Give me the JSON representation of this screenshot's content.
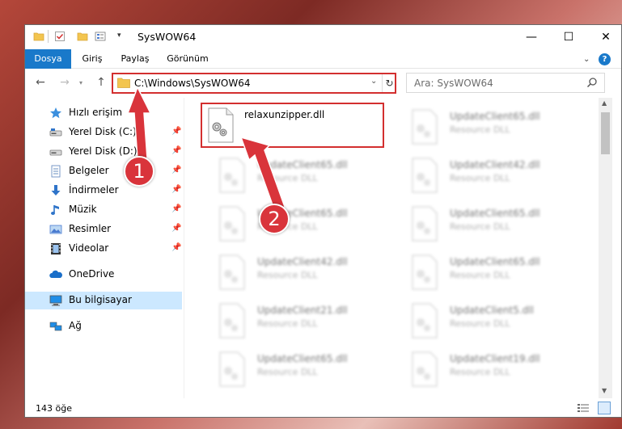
{
  "window": {
    "title": "SysWOW64",
    "controls": {
      "minimize": "—",
      "maximize": "☐",
      "close": "✕"
    }
  },
  "ribbon": {
    "file_tab": "Dosya",
    "tabs": [
      "Giriş",
      "Paylaş",
      "Görünüm"
    ],
    "help": "?"
  },
  "navigation": {
    "address": "C:\\Windows\\SysWOW64",
    "search_placeholder": "Ara: SysWOW64"
  },
  "sidebar": {
    "items": [
      {
        "label": "Hızlı erişim",
        "icon": "star-icon",
        "pinned": false,
        "selected": false
      },
      {
        "label": "Yerel Disk (C:)",
        "icon": "drive-icon",
        "pinned": true,
        "selected": false
      },
      {
        "label": "Yerel Disk (D:)",
        "icon": "drive-icon",
        "pinned": true,
        "selected": false
      },
      {
        "label": "Belgeler",
        "icon": "documents-icon",
        "pinned": true,
        "selected": false
      },
      {
        "label": "İndirmeler",
        "icon": "downloads-icon",
        "pinned": true,
        "selected": false
      },
      {
        "label": "Müzik",
        "icon": "music-icon",
        "pinned": true,
        "selected": false
      },
      {
        "label": "Resimler",
        "icon": "pictures-icon",
        "pinned": true,
        "selected": false
      },
      {
        "label": "Videolar",
        "icon": "videos-icon",
        "pinned": true,
        "selected": false
      },
      {
        "label": "OneDrive",
        "icon": "onedrive-icon",
        "pinned": false,
        "selected": false
      },
      {
        "label": "Bu bilgisayar",
        "icon": "computer-icon",
        "pinned": false,
        "selected": true
      },
      {
        "label": "Ağ",
        "icon": "network-icon",
        "pinned": false,
        "selected": false
      }
    ]
  },
  "files": [
    {
      "name": "relaxunzipper.dll",
      "type": "",
      "highlighted": true,
      "blurred": false
    },
    {
      "name": "UpdateClient65.dll",
      "type": "Resource DLL",
      "highlighted": false,
      "blurred": true
    },
    {
      "name": "UpdateClient65.dll",
      "type": "Resource DLL",
      "highlighted": false,
      "blurred": true
    },
    {
      "name": "UpdateClient42.dll",
      "type": "Resource DLL",
      "highlighted": false,
      "blurred": true
    },
    {
      "name": "UpdateClient65.dll",
      "type": "Resource DLL",
      "highlighted": false,
      "blurred": true
    },
    {
      "name": "UpdateClient65.dll",
      "type": "Resource DLL",
      "highlighted": false,
      "blurred": true
    },
    {
      "name": "UpdateClient42.dll",
      "type": "Resource DLL",
      "highlighted": false,
      "blurred": true
    },
    {
      "name": "UpdateClient65.dll",
      "type": "Resource DLL",
      "highlighted": false,
      "blurred": true
    },
    {
      "name": "UpdateClient21.dll",
      "type": "Resource DLL",
      "highlighted": false,
      "blurred": true
    },
    {
      "name": "UpdateClient5.dll",
      "type": "Resource DLL",
      "highlighted": false,
      "blurred": true
    },
    {
      "name": "UpdateClient65.dll",
      "type": "Resource DLL",
      "highlighted": false,
      "blurred": true
    },
    {
      "name": "UpdateClient19.dll",
      "type": "Resource DLL",
      "highlighted": false,
      "blurred": true
    }
  ],
  "status": {
    "item_count": "143 öğe"
  },
  "annotations": {
    "step1": "1",
    "step2": "2"
  },
  "colors": {
    "accent": "#1979ca",
    "highlight": "#d32f2f",
    "selection": "#cce8ff"
  }
}
